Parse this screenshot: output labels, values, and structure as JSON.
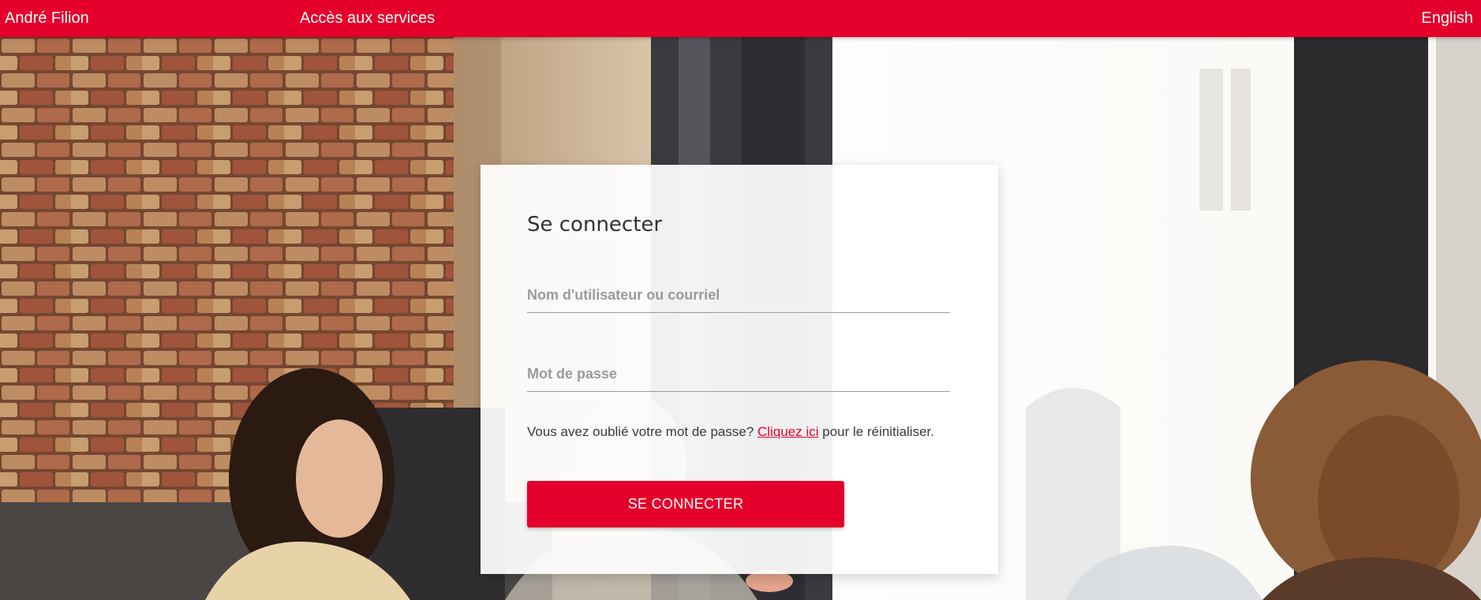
{
  "header": {
    "brand": "André Filion",
    "services_link": "Accès aux services",
    "language_link": "English"
  },
  "login": {
    "title": "Se connecter",
    "username_placeholder": "Nom d'utilisateur ou courriel",
    "username_value": "",
    "password_placeholder": "Mot de passe",
    "password_value": "",
    "forgot_prefix": "Vous avez oublié votre mot de passe?",
    "forgot_link": "Cliquez ici",
    "forgot_suffix": "pour le réinitialiser.",
    "submit_label": "SE CONNECTER"
  },
  "colors": {
    "brand_red": "#e4002b",
    "text_dark": "#333333",
    "placeholder_gray": "#9a9a9a"
  }
}
